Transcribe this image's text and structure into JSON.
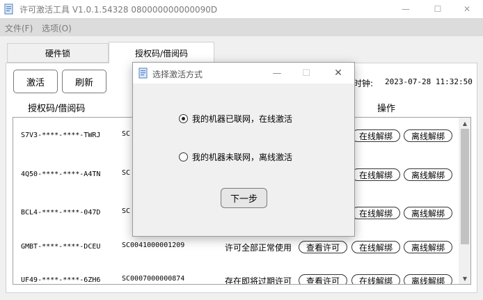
{
  "window": {
    "title": "许可激活工具 V1.0.1.54328  080000000000090D",
    "min_glyph": "—",
    "max_glyph": "☐",
    "close_glyph": "✕"
  },
  "menu": {
    "items": [
      {
        "label": "文件(F)"
      },
      {
        "label": "选项(O)"
      }
    ]
  },
  "tabs": [
    {
      "label": "硬件锁",
      "active": false
    },
    {
      "label": "授权码/借阅码",
      "active": true
    }
  ],
  "toolbar": {
    "activate_label": "激活",
    "refresh_label": "刷新"
  },
  "clock": {
    "label": "时钟:",
    "value": "2023-07-28 11:32:50"
  },
  "table": {
    "header_code": "授权码/借阅码",
    "header_op": "操作",
    "rows": [
      {
        "code": "S7V3-****-****-TWRJ",
        "sn": "SC",
        "status": "",
        "view": "",
        "online": "在线解绑",
        "offline": "离线解绑"
      },
      {
        "code": "4Q50-****-****-A4TN",
        "sn": "SC",
        "status": "",
        "view": "",
        "online": "在线解绑",
        "offline": "离线解绑"
      },
      {
        "code": "BCL4-****-****-047D",
        "sn": "SC",
        "status": "",
        "view": "",
        "online": "在线解绑",
        "offline": "离线解绑"
      },
      {
        "code": "GMBT-****-****-DCEU",
        "sn": "SC0041000001209",
        "status": "许可全部正常使用",
        "view": "查看许可",
        "online": "在线解绑",
        "offline": "离线解绑"
      },
      {
        "code": "UF49-****-****-6ZH6",
        "sn": "SC0007000000874",
        "status": "存在即将过期许可",
        "view": "查看许可",
        "online": "在线解绑",
        "offline": "离线解绑"
      }
    ]
  },
  "dialog": {
    "title": "选择激活方式",
    "option_online": "我的机器已联网，在线激活",
    "option_offline": "我的机器未联网，离线激活",
    "selected": "online",
    "next_label": "下一步"
  },
  "colors": {
    "accent": "#4a7fc1",
    "window_bg": "#f0f0f0",
    "menubar_bg": "#dcdcdc"
  }
}
